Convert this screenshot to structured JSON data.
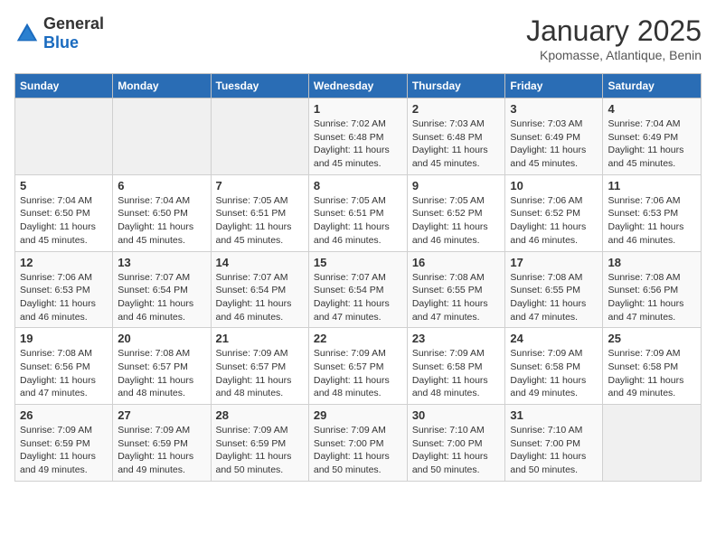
{
  "logo": {
    "general": "General",
    "blue": "Blue"
  },
  "header": {
    "month": "January 2025",
    "location": "Kpomasse, Atlantique, Benin"
  },
  "weekdays": [
    "Sunday",
    "Monday",
    "Tuesday",
    "Wednesday",
    "Thursday",
    "Friday",
    "Saturday"
  ],
  "weeks": [
    [
      {
        "day": "",
        "info": ""
      },
      {
        "day": "",
        "info": ""
      },
      {
        "day": "",
        "info": ""
      },
      {
        "day": "1",
        "info": "Sunrise: 7:02 AM\nSunset: 6:48 PM\nDaylight: 11 hours and 45 minutes."
      },
      {
        "day": "2",
        "info": "Sunrise: 7:03 AM\nSunset: 6:48 PM\nDaylight: 11 hours and 45 minutes."
      },
      {
        "day": "3",
        "info": "Sunrise: 7:03 AM\nSunset: 6:49 PM\nDaylight: 11 hours and 45 minutes."
      },
      {
        "day": "4",
        "info": "Sunrise: 7:04 AM\nSunset: 6:49 PM\nDaylight: 11 hours and 45 minutes."
      }
    ],
    [
      {
        "day": "5",
        "info": "Sunrise: 7:04 AM\nSunset: 6:50 PM\nDaylight: 11 hours and 45 minutes."
      },
      {
        "day": "6",
        "info": "Sunrise: 7:04 AM\nSunset: 6:50 PM\nDaylight: 11 hours and 45 minutes."
      },
      {
        "day": "7",
        "info": "Sunrise: 7:05 AM\nSunset: 6:51 PM\nDaylight: 11 hours and 45 minutes."
      },
      {
        "day": "8",
        "info": "Sunrise: 7:05 AM\nSunset: 6:51 PM\nDaylight: 11 hours and 46 minutes."
      },
      {
        "day": "9",
        "info": "Sunrise: 7:05 AM\nSunset: 6:52 PM\nDaylight: 11 hours and 46 minutes."
      },
      {
        "day": "10",
        "info": "Sunrise: 7:06 AM\nSunset: 6:52 PM\nDaylight: 11 hours and 46 minutes."
      },
      {
        "day": "11",
        "info": "Sunrise: 7:06 AM\nSunset: 6:53 PM\nDaylight: 11 hours and 46 minutes."
      }
    ],
    [
      {
        "day": "12",
        "info": "Sunrise: 7:06 AM\nSunset: 6:53 PM\nDaylight: 11 hours and 46 minutes."
      },
      {
        "day": "13",
        "info": "Sunrise: 7:07 AM\nSunset: 6:54 PM\nDaylight: 11 hours and 46 minutes."
      },
      {
        "day": "14",
        "info": "Sunrise: 7:07 AM\nSunset: 6:54 PM\nDaylight: 11 hours and 46 minutes."
      },
      {
        "day": "15",
        "info": "Sunrise: 7:07 AM\nSunset: 6:54 PM\nDaylight: 11 hours and 47 minutes."
      },
      {
        "day": "16",
        "info": "Sunrise: 7:08 AM\nSunset: 6:55 PM\nDaylight: 11 hours and 47 minutes."
      },
      {
        "day": "17",
        "info": "Sunrise: 7:08 AM\nSunset: 6:55 PM\nDaylight: 11 hours and 47 minutes."
      },
      {
        "day": "18",
        "info": "Sunrise: 7:08 AM\nSunset: 6:56 PM\nDaylight: 11 hours and 47 minutes."
      }
    ],
    [
      {
        "day": "19",
        "info": "Sunrise: 7:08 AM\nSunset: 6:56 PM\nDaylight: 11 hours and 47 minutes."
      },
      {
        "day": "20",
        "info": "Sunrise: 7:08 AM\nSunset: 6:57 PM\nDaylight: 11 hours and 48 minutes."
      },
      {
        "day": "21",
        "info": "Sunrise: 7:09 AM\nSunset: 6:57 PM\nDaylight: 11 hours and 48 minutes."
      },
      {
        "day": "22",
        "info": "Sunrise: 7:09 AM\nSunset: 6:57 PM\nDaylight: 11 hours and 48 minutes."
      },
      {
        "day": "23",
        "info": "Sunrise: 7:09 AM\nSunset: 6:58 PM\nDaylight: 11 hours and 48 minutes."
      },
      {
        "day": "24",
        "info": "Sunrise: 7:09 AM\nSunset: 6:58 PM\nDaylight: 11 hours and 49 minutes."
      },
      {
        "day": "25",
        "info": "Sunrise: 7:09 AM\nSunset: 6:58 PM\nDaylight: 11 hours and 49 minutes."
      }
    ],
    [
      {
        "day": "26",
        "info": "Sunrise: 7:09 AM\nSunset: 6:59 PM\nDaylight: 11 hours and 49 minutes."
      },
      {
        "day": "27",
        "info": "Sunrise: 7:09 AM\nSunset: 6:59 PM\nDaylight: 11 hours and 49 minutes."
      },
      {
        "day": "28",
        "info": "Sunrise: 7:09 AM\nSunset: 6:59 PM\nDaylight: 11 hours and 50 minutes."
      },
      {
        "day": "29",
        "info": "Sunrise: 7:09 AM\nSunset: 7:00 PM\nDaylight: 11 hours and 50 minutes."
      },
      {
        "day": "30",
        "info": "Sunrise: 7:10 AM\nSunset: 7:00 PM\nDaylight: 11 hours and 50 minutes."
      },
      {
        "day": "31",
        "info": "Sunrise: 7:10 AM\nSunset: 7:00 PM\nDaylight: 11 hours and 50 minutes."
      },
      {
        "day": "",
        "info": ""
      }
    ]
  ]
}
